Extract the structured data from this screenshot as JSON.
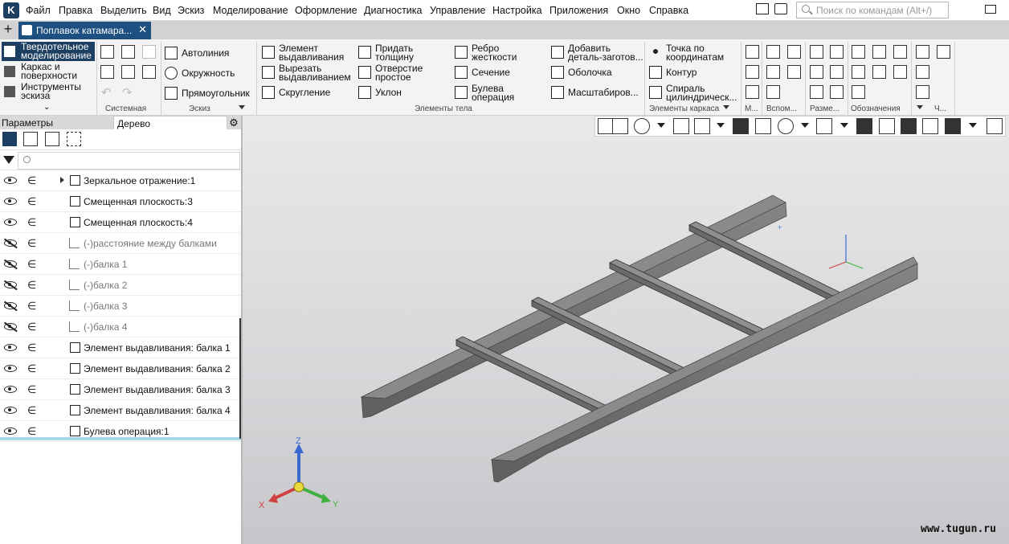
{
  "menu": {
    "items": [
      "Файл",
      "Правка",
      "Выделить",
      "Вид",
      "Эскиз",
      "Моделирование",
      "Оформление",
      "Диагностика",
      "Управление",
      "Настройка",
      "Приложения",
      "Окно",
      "Справка"
    ],
    "search_placeholder": "Поиск по командам (Alt+/)"
  },
  "tab": {
    "title": "Поплавок катамара...",
    "close": "✕",
    "add": "+"
  },
  "ribbon": {
    "modes": [
      "Твердотельное моделирование",
      "Каркас и поверхности",
      "Инструменты эскиза"
    ],
    "sketch": [
      "Автолиния",
      "Окружность",
      "Прямоугольник"
    ],
    "body": {
      "col1": [
        "Элемент выдавливания",
        "Вырезать выдавливанием",
        "Скругление"
      ],
      "col2": [
        "Придать толщину",
        "Отверстие простое",
        "Уклон"
      ],
      "col3": [
        "Ребро жесткости",
        "Сечение",
        "Булева операция"
      ],
      "col4": [
        "Добавить деталь-заготов...",
        "Оболочка",
        "Масштабиров..."
      ]
    },
    "frame": [
      "Точка по координатам",
      "Контур",
      "Спираль цилиндрическ..."
    ],
    "groups": [
      "Системная",
      "Эскиз",
      "Элементы тела",
      "Элементы каркаса",
      "М...",
      "Вспом...",
      "Разме...",
      "Обозначения",
      "Ч..."
    ]
  },
  "panel": {
    "tab_params": "Параметры",
    "tab_tree": "Дерево",
    "filter_placeholder": ""
  },
  "tree": [
    {
      "name": "Зеркальное отражение:1",
      "visible": true,
      "expandable": true,
      "dim": false,
      "icon": "mirror-icon"
    },
    {
      "name": "Смещенная плоскость:3",
      "visible": true,
      "dim": false,
      "icon": "plane-icon"
    },
    {
      "name": "Смещенная плоскость:4",
      "visible": true,
      "dim": false,
      "icon": "plane-icon"
    },
    {
      "name": "(-)расстояние между балками",
      "visible": false,
      "dim": true,
      "icon": "sketch-icon"
    },
    {
      "name": "(-)балка 1",
      "visible": false,
      "dim": true,
      "icon": "sketch-icon"
    },
    {
      "name": "(-)балка 2",
      "visible": false,
      "dim": true,
      "icon": "sketch-icon"
    },
    {
      "name": "(-)балка 3",
      "visible": false,
      "dim": true,
      "icon": "sketch-icon"
    },
    {
      "name": "(-)балка 4",
      "visible": false,
      "dim": true,
      "icon": "sketch-icon"
    },
    {
      "name": "Элемент выдавливания: балка 1",
      "visible": true,
      "dim": false,
      "icon": "extrude-icon"
    },
    {
      "name": "Элемент выдавливания: балка 2",
      "visible": true,
      "dim": false,
      "icon": "extrude-icon"
    },
    {
      "name": "Элемент выдавливания: балка 3",
      "visible": true,
      "dim": false,
      "icon": "extrude-icon"
    },
    {
      "name": "Элемент выдавливания: балка 4",
      "visible": true,
      "dim": false,
      "icon": "extrude-icon"
    },
    {
      "name": "Булева операция:1",
      "visible": true,
      "dim": false,
      "icon": "boolean-icon"
    }
  ],
  "axes": {
    "x": "X",
    "y": "Y",
    "z": "Z"
  },
  "watermark": "www.tugun.ru",
  "colors": {
    "accent": "#1d3f61",
    "tab": "#1d4f80",
    "model": "#6f6f6f",
    "selection": "#a9d7ea"
  }
}
